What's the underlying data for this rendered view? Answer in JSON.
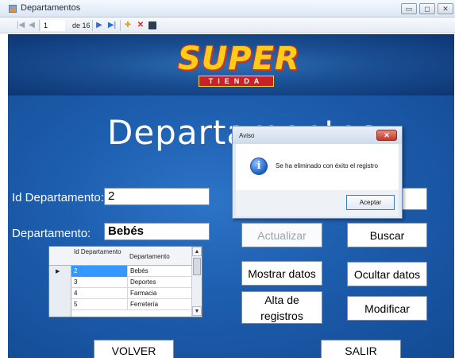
{
  "window": {
    "title": "Departamentos"
  },
  "nav": {
    "first": "|◀",
    "prev": "◀",
    "position": "1",
    "count": "de 16",
    "next": "▶",
    "last": "▶|",
    "add": "✚",
    "delete": "✕",
    "save": "💾"
  },
  "banner": {
    "logo_main": "SUPER",
    "logo_sub": "TIENDA"
  },
  "form": {
    "title": "Departamentos",
    "id_label": "Id Departamento:",
    "id_value": "2",
    "dept_label": "Departamento:",
    "dept_value": "Bebés"
  },
  "grid": {
    "columns": [
      "Id Departamento",
      "Departamento"
    ],
    "rows": [
      {
        "id": "2",
        "name": "Bebés"
      },
      {
        "id": "3",
        "name": "Deportes"
      },
      {
        "id": "4",
        "name": "Farmacia"
      },
      {
        "id": "5",
        "name": "Ferretería"
      }
    ]
  },
  "buttons": {
    "actualizar": "Actualizar",
    "buscar": "Buscar",
    "mostrar": "Mostrar datos",
    "ocultar": "Ocultar datos",
    "alta": "Alta de registros",
    "modificar": "Modificar",
    "volver": "VOLVER",
    "salir": "SALIR"
  },
  "dialog": {
    "title": "Aviso",
    "message": "Se ha eliminado con éxito el registro",
    "ok": "Aceptar"
  }
}
